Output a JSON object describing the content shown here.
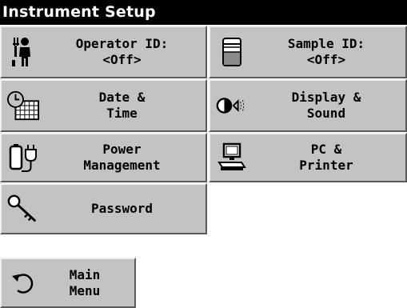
{
  "title": "Instrument Setup",
  "tiles": {
    "operator_id": {
      "line1": "Operator ID:",
      "line2": "<Off>",
      "icon": "operator-icon"
    },
    "sample_id": {
      "line1": "Sample ID:",
      "line2": "<Off>",
      "icon": "sample-vial-icon"
    },
    "date_time": {
      "line1": "Date &",
      "line2": "Time",
      "icon": "clock-calendar-icon"
    },
    "display_sound": {
      "line1": "Display &",
      "line2": "Sound",
      "icon": "display-sound-icon"
    },
    "power": {
      "line1": "Power",
      "line2": "Management",
      "icon": "power-plug-icon"
    },
    "pc_printer": {
      "line1": "PC &",
      "line2": "Printer",
      "icon": "computer-icon"
    },
    "password": {
      "line1": "Password",
      "icon": "key-icon"
    }
  },
  "main_menu": {
    "line1": "Main",
    "line2": "Menu",
    "icon": "back-arrow-icon"
  },
  "colors": {
    "title_bg": "#000000",
    "tile_bg": "#c3c3c3",
    "page_bg": "#ffffff"
  }
}
